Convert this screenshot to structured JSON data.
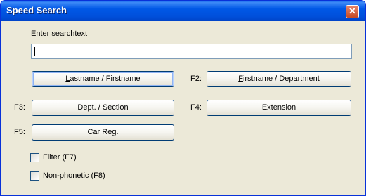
{
  "window": {
    "title": "Speed Search",
    "close_glyph": "✕"
  },
  "search": {
    "label": "Enter searchtext",
    "value": ""
  },
  "buttons": {
    "lastname": {
      "hotkey_letter": "L",
      "rest": "astname / Firstname"
    },
    "firstname_department": {
      "shortcut": "F2:",
      "hotkey_letter": "F",
      "rest": "irstname / Department"
    },
    "dept_section": {
      "shortcut": "F3:",
      "label": "Dept. / Section"
    },
    "extension": {
      "shortcut": "F4:",
      "label": "Extension"
    },
    "car_reg": {
      "shortcut": "F5:",
      "label": "Car Reg."
    }
  },
  "options": {
    "filter": {
      "label": "Filter (F7)",
      "checked": false
    },
    "non_phonetic": {
      "label": "Non-phonetic (F8)",
      "checked": false
    }
  }
}
